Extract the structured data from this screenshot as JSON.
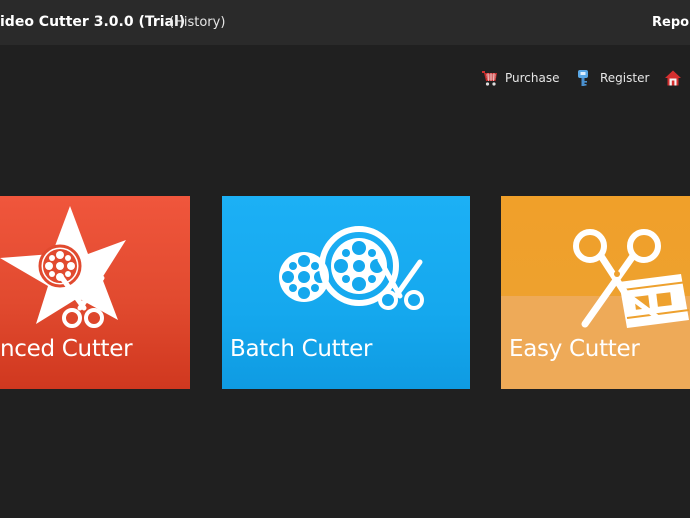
{
  "titlebar": {
    "title": "ideo Cutter 3.0.0 (Trial)",
    "history_label": "(History)",
    "report_label": "Repor"
  },
  "toplinks": {
    "purchase_label": "Purchase",
    "register_label": "Register",
    "purchase_icon": "cart-icon",
    "register_icon": "key-icon",
    "home_icon": "home-icon"
  },
  "tiles": [
    {
      "label": "nced Cutter",
      "color": "#e8472d",
      "icon": "star-film-scissors-icon"
    },
    {
      "label": "Batch Cutter",
      "color": "#16a9ef",
      "icon": "film-reels-scissors-icon"
    },
    {
      "label": "Easy Cutter",
      "color": "#eea12e",
      "icon": "scissors-filmstrip-icon"
    }
  ]
}
